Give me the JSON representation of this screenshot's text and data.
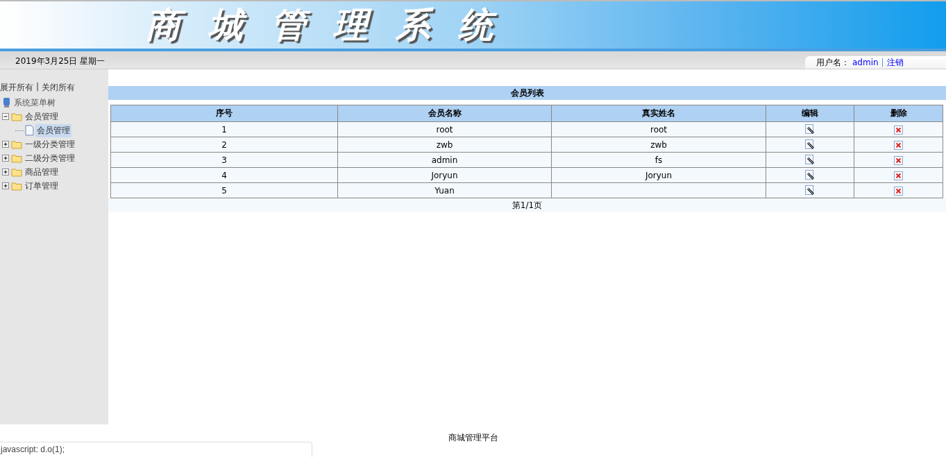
{
  "banner": {
    "title": "商城管理系统"
  },
  "info_bar": {
    "date": "2019年3月25日 星期一",
    "user_label": "用户名：",
    "username": "admin",
    "separator": "|",
    "logout": "注销"
  },
  "sidebar": {
    "expand_all": "展开所有",
    "separator": "|",
    "collapse_all": "关闭所有",
    "root": "系统菜单树",
    "items": [
      {
        "label": "会员管理",
        "expanded": true,
        "selected": false,
        "children": [
          {
            "label": "会员管理",
            "selected": true
          }
        ]
      },
      {
        "label": "一级分类管理",
        "expanded": false,
        "selected": false
      },
      {
        "label": "二级分类管理",
        "expanded": false,
        "selected": false
      },
      {
        "label": "商品管理",
        "expanded": false,
        "selected": false
      },
      {
        "label": "订单管理",
        "expanded": false,
        "selected": false
      }
    ]
  },
  "table": {
    "title": "会员列表",
    "columns": [
      "序号",
      "会员名称",
      "真实姓名",
      "编辑",
      "删除"
    ],
    "rows": [
      {
        "index": "1",
        "name": "root",
        "real_name": "root"
      },
      {
        "index": "2",
        "name": "zwb",
        "real_name": "zwb"
      },
      {
        "index": "3",
        "name": "admin",
        "real_name": "fs"
      },
      {
        "index": "4",
        "name": "Joryun",
        "real_name": "Joryun"
      },
      {
        "index": "5",
        "name": "Yuan",
        "real_name": ""
      }
    ],
    "pagination": "第1/1页"
  },
  "footer": "商城管理平台",
  "status_bar": "javascript: d.o(1);"
}
